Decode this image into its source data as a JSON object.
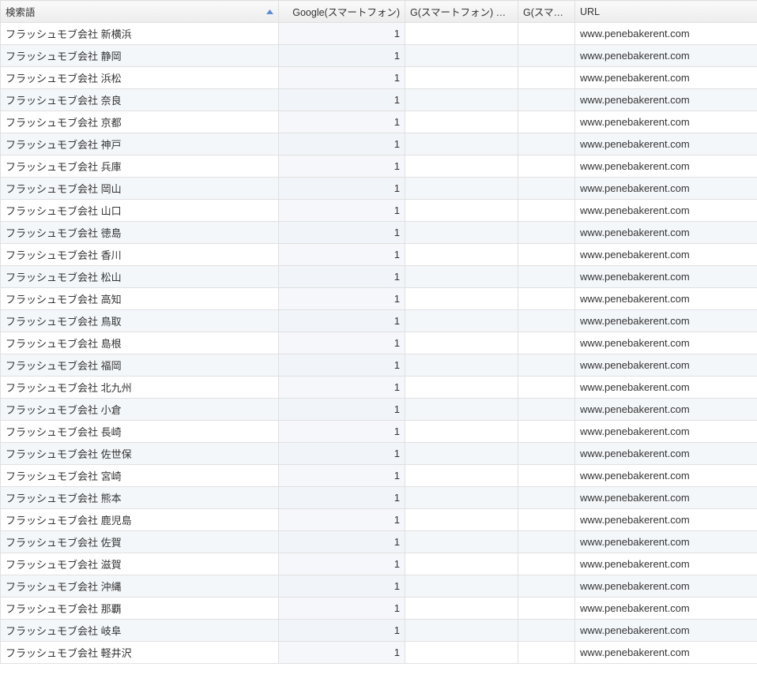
{
  "headers": {
    "term": "検索語",
    "google": "Google(スマートフォン)",
    "change": "G(スマートフォン) 変化",
    "sub": "G(スマートフ..",
    "url": "URL"
  },
  "rows": [
    {
      "term": "フラッシュモブ会社 新横浜",
      "google": "1",
      "change": "",
      "sub": "",
      "url": "www.penebakerent.com"
    },
    {
      "term": "フラッシュモブ会社 静岡",
      "google": "1",
      "change": "",
      "sub": "",
      "url": "www.penebakerent.com"
    },
    {
      "term": "フラッシュモブ会社 浜松",
      "google": "1",
      "change": "",
      "sub": "",
      "url": "www.penebakerent.com"
    },
    {
      "term": "フラッシュモブ会社 奈良",
      "google": "1",
      "change": "",
      "sub": "",
      "url": "www.penebakerent.com"
    },
    {
      "term": "フラッシュモブ会社 京都",
      "google": "1",
      "change": "",
      "sub": "",
      "url": "www.penebakerent.com"
    },
    {
      "term": "フラッシュモブ会社 神戸",
      "google": "1",
      "change": "",
      "sub": "",
      "url": "www.penebakerent.com"
    },
    {
      "term": "フラッシュモブ会社 兵庫",
      "google": "1",
      "change": "",
      "sub": "",
      "url": "www.penebakerent.com"
    },
    {
      "term": "フラッシュモブ会社 岡山",
      "google": "1",
      "change": "",
      "sub": "",
      "url": "www.penebakerent.com"
    },
    {
      "term": "フラッシュモブ会社 山口",
      "google": "1",
      "change": "",
      "sub": "",
      "url": "www.penebakerent.com"
    },
    {
      "term": "フラッシュモブ会社 徳島",
      "google": "1",
      "change": "",
      "sub": "",
      "url": "www.penebakerent.com"
    },
    {
      "term": "フラッシュモブ会社 香川",
      "google": "1",
      "change": "",
      "sub": "",
      "url": "www.penebakerent.com"
    },
    {
      "term": "フラッシュモブ会社 松山",
      "google": "1",
      "change": "",
      "sub": "",
      "url": "www.penebakerent.com"
    },
    {
      "term": "フラッシュモブ会社 高知",
      "google": "1",
      "change": "",
      "sub": "",
      "url": "www.penebakerent.com"
    },
    {
      "term": "フラッシュモブ会社 鳥取",
      "google": "1",
      "change": "",
      "sub": "",
      "url": "www.penebakerent.com"
    },
    {
      "term": "フラッシュモブ会社 島根",
      "google": "1",
      "change": "",
      "sub": "",
      "url": "www.penebakerent.com"
    },
    {
      "term": "フラッシュモブ会社 福岡",
      "google": "1",
      "change": "",
      "sub": "",
      "url": "www.penebakerent.com"
    },
    {
      "term": "フラッシュモブ会社 北九州",
      "google": "1",
      "change": "",
      "sub": "",
      "url": "www.penebakerent.com"
    },
    {
      "term": "フラッシュモブ会社 小倉",
      "google": "1",
      "change": "",
      "sub": "",
      "url": "www.penebakerent.com"
    },
    {
      "term": "フラッシュモブ会社 長崎",
      "google": "1",
      "change": "",
      "sub": "",
      "url": "www.penebakerent.com"
    },
    {
      "term": "フラッシュモブ会社 佐世保",
      "google": "1",
      "change": "",
      "sub": "",
      "url": "www.penebakerent.com"
    },
    {
      "term": "フラッシュモブ会社 宮崎",
      "google": "1",
      "change": "",
      "sub": "",
      "url": "www.penebakerent.com"
    },
    {
      "term": "フラッシュモブ会社 熊本",
      "google": "1",
      "change": "",
      "sub": "",
      "url": "www.penebakerent.com"
    },
    {
      "term": "フラッシュモブ会社 鹿児島",
      "google": "1",
      "change": "",
      "sub": "",
      "url": "www.penebakerent.com"
    },
    {
      "term": "フラッシュモブ会社 佐賀",
      "google": "1",
      "change": "",
      "sub": "",
      "url": "www.penebakerent.com"
    },
    {
      "term": "フラッシュモブ会社 滋賀",
      "google": "1",
      "change": "",
      "sub": "",
      "url": "www.penebakerent.com"
    },
    {
      "term": "フラッシュモブ会社 沖縄",
      "google": "1",
      "change": "",
      "sub": "",
      "url": "www.penebakerent.com"
    },
    {
      "term": "フラッシュモブ会社 那覇",
      "google": "1",
      "change": "",
      "sub": "",
      "url": "www.penebakerent.com"
    },
    {
      "term": "フラッシュモブ会社 岐阜",
      "google": "1",
      "change": "",
      "sub": "",
      "url": "www.penebakerent.com"
    },
    {
      "term": "フラッシュモブ会社 軽井沢",
      "google": "1",
      "change": "",
      "sub": "",
      "url": "www.penebakerent.com"
    }
  ]
}
